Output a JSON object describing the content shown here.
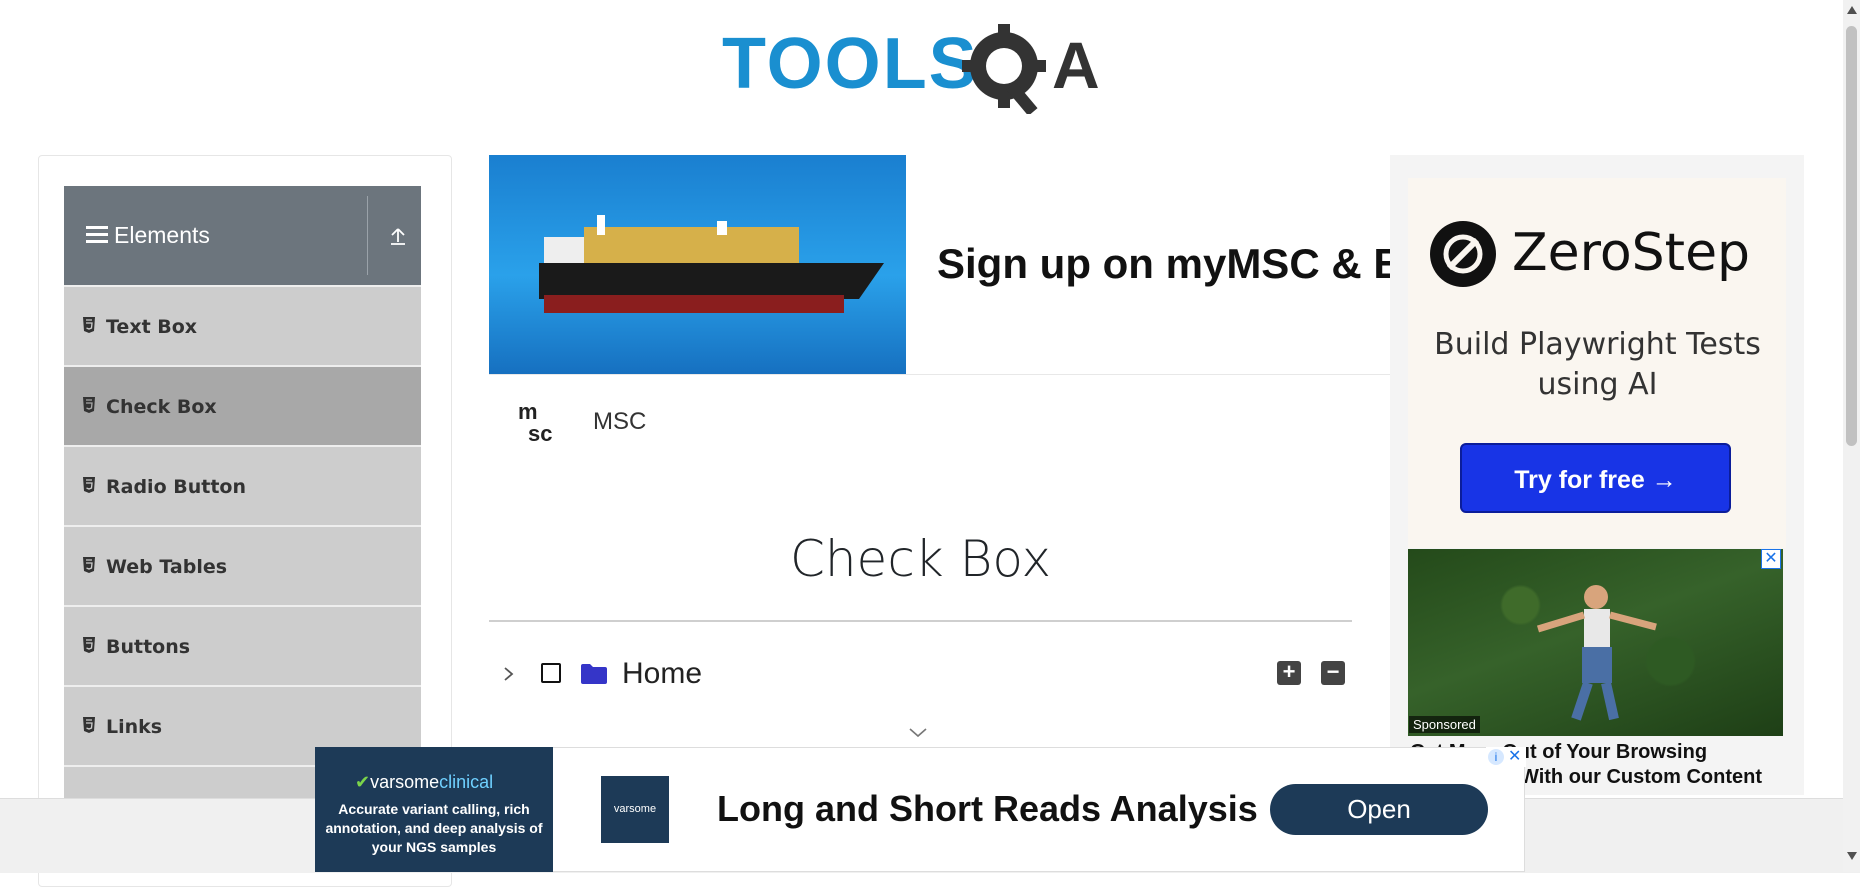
{
  "header": {
    "logo_text": "TOOLSQA"
  },
  "sidebar": {
    "group_title": "Elements",
    "items": [
      {
        "label": "Text Box"
      },
      {
        "label": "Check Box",
        "active": true
      },
      {
        "label": "Radio Button"
      },
      {
        "label": "Web Tables"
      },
      {
        "label": "Buttons"
      },
      {
        "label": "Links"
      }
    ]
  },
  "ad_top": {
    "headline": "Sign up on myMSC & B",
    "brand": "MSC"
  },
  "main": {
    "heading": "Check Box",
    "tree": {
      "root_label": "Home",
      "expand_symbol": "+",
      "collapse_symbol": "−"
    }
  },
  "ad_right": {
    "brand": "ZeroStep",
    "tagline": "Build Playwright Tests using AI",
    "cta": "Try for free →",
    "sponsored_badge": "Sponsored",
    "sponsored_text_line1": "Get More Out of Your Browsing",
    "sponsored_text_line2": "With our Custom Content",
    "close_symbol": "✕"
  },
  "ad_bottom": {
    "brand_prefix": "varsome",
    "brand_suffix": "clinical",
    "description": "Accurate variant calling, rich annotation, and deep analysis of your NGS samples",
    "small_logo": "varsome",
    "headline": "Long and Short Reads Analysis",
    "button": "Open",
    "adchoices_i": "i",
    "adchoices_x": "✕"
  },
  "colors": {
    "sidebar_header": "#6c757d",
    "menu_item": "#cdcdcd",
    "menu_item_active": "#a8a8a8",
    "cta_blue": "#1834e6",
    "logo_blue": "#1a8fd0",
    "folder_purple": "#3535c8"
  }
}
